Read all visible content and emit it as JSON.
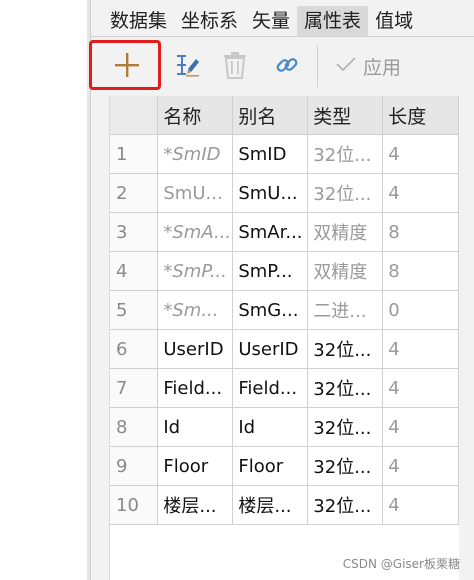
{
  "tabs": [
    {
      "label": "数据集",
      "active": false
    },
    {
      "label": "坐标系",
      "active": false
    },
    {
      "label": "矢量",
      "active": false
    },
    {
      "label": "属性表",
      "active": true
    },
    {
      "label": "值域",
      "active": false
    }
  ],
  "toolbar": {
    "add_icon": "plus-icon",
    "edit_icon": "edit-field-icon",
    "delete_icon": "trash-icon",
    "link_icon": "link-icon",
    "apply_icon": "check-icon",
    "apply_label": "应用",
    "highlight_color": "#e21b1b",
    "accent_color": "#b07a3a"
  },
  "table": {
    "columns": [
      "",
      "名称",
      "别名",
      "类型",
      "长度"
    ],
    "rows": [
      {
        "idx": "1",
        "name": "*SmID",
        "alias": "SmID",
        "type": "32位...",
        "length": "4",
        "system": true
      },
      {
        "idx": "2",
        "name": "SmU...",
        "alias": "SmU...",
        "type": "32位...",
        "length": "4",
        "system": true
      },
      {
        "idx": "3",
        "name": "*SmA...",
        "alias": "SmAr...",
        "type": "双精度",
        "length": "8",
        "system": true
      },
      {
        "idx": "4",
        "name": "*SmP...",
        "alias": "SmP...",
        "type": "双精度",
        "length": "8",
        "system": true
      },
      {
        "idx": "5",
        "name": "*Sm...",
        "alias": "SmG...",
        "type": "二进...",
        "length": "0",
        "system": true
      },
      {
        "idx": "6",
        "name": "UserID",
        "alias": "UserID",
        "type": "32位...",
        "length": "4",
        "system": false
      },
      {
        "idx": "7",
        "name": "Field...",
        "alias": "Field...",
        "type": "32位...",
        "length": "4",
        "system": false
      },
      {
        "idx": "8",
        "name": "Id",
        "alias": "Id",
        "type": "32位...",
        "length": "4",
        "system": false
      },
      {
        "idx": "9",
        "name": "Floor",
        "alias": "Floor",
        "type": "32位...",
        "length": "4",
        "system": false
      },
      {
        "idx": "10",
        "name": "楼层...",
        "alias": "楼层...",
        "type": "32位...",
        "length": "4",
        "system": false
      }
    ]
  },
  "watermark": "CSDN @Giser板栗糖"
}
